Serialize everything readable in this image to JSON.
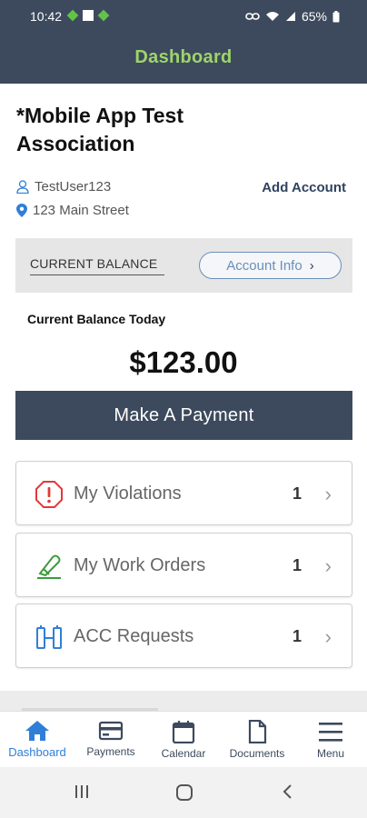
{
  "status_bar": {
    "time": "10:42",
    "battery": "65%"
  },
  "app_bar": {
    "title": "Dashboard"
  },
  "association": {
    "name": "*Mobile App Test Association",
    "username": "TestUser123",
    "address": "123 Main Street",
    "add_account_label": "Add Account"
  },
  "balance_panel": {
    "label": "CURRENT BALANCE",
    "account_info_label": "Account Info",
    "today_label": "Current Balance Today",
    "amount": "$123.00"
  },
  "payment_button": {
    "label": "Make A Payment"
  },
  "cards": [
    {
      "label": "My Violations",
      "count": "1",
      "icon": "violation-icon"
    },
    {
      "label": "My Work Orders",
      "count": "1",
      "icon": "work-order-icon"
    },
    {
      "label": "ACC Requests",
      "count": "1",
      "icon": "acc-request-icon"
    }
  ],
  "tabs": [
    {
      "label": "Dashboard",
      "icon": "home-icon",
      "active": true
    },
    {
      "label": "Payments",
      "icon": "credit-card-icon",
      "active": false
    },
    {
      "label": "Calendar",
      "icon": "calendar-icon",
      "active": false
    },
    {
      "label": "Documents",
      "icon": "document-icon",
      "active": false
    },
    {
      "label": "Menu",
      "icon": "hamburger-icon",
      "active": false
    }
  ],
  "colors": {
    "header_bg": "#3d4a5d",
    "header_title": "#9ed46b",
    "active_tab": "#2f7fd8",
    "violation_red": "#e03a3a",
    "work_order_green": "#3c9b3c",
    "acc_blue": "#2f7fd8"
  }
}
